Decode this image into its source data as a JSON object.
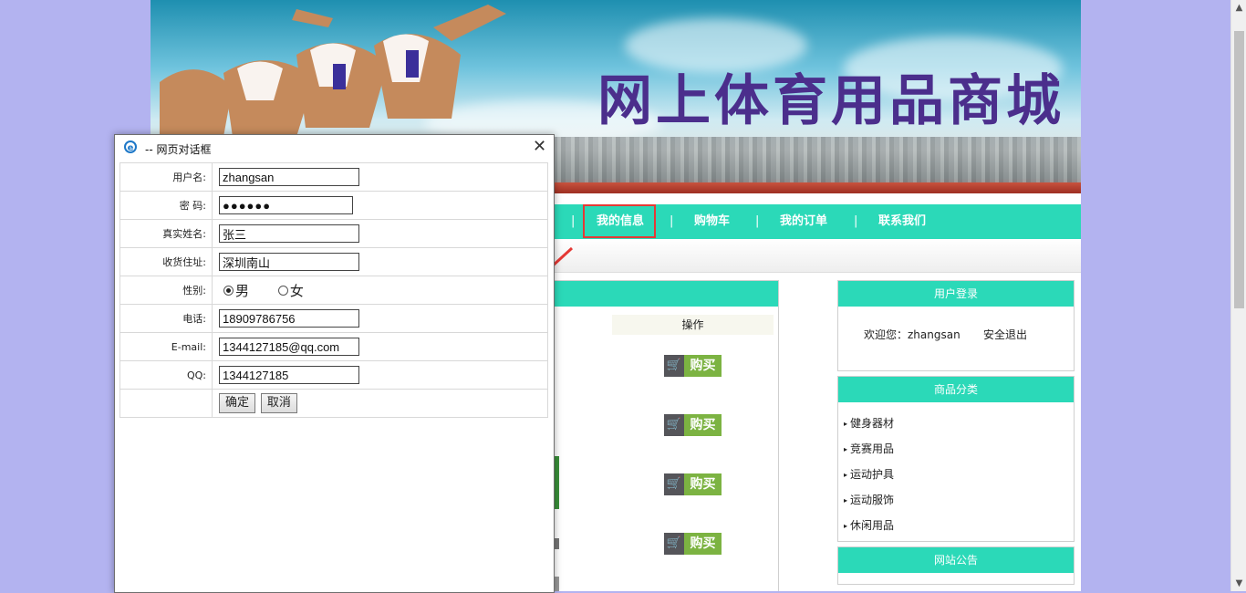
{
  "banner": {
    "title": "网上体育用品商城"
  },
  "nav": {
    "items": [
      "我的信息",
      "购物车",
      "我的订单",
      "联系我们"
    ],
    "separator": "|"
  },
  "products": {
    "column_header": "操作",
    "buy_label": "购买",
    "buy_count": 4
  },
  "login_box": {
    "title": "用户登录",
    "welcome": "欢迎您：zhangsan",
    "logout": "安全退出"
  },
  "category_box": {
    "title": "商品分类",
    "items": [
      "健身器材",
      "竞赛用品",
      "运动护具",
      "运动服饰",
      "休闲用品"
    ]
  },
  "notice_box": {
    "title": "网站公告"
  },
  "dialog": {
    "title": "-- 网页对话框",
    "fields": {
      "username": {
        "label": "用户名:",
        "value": "zhangsan"
      },
      "password": {
        "label": "密 码:",
        "value": "●●●●●●"
      },
      "realname": {
        "label": "真实姓名:",
        "value": "张三"
      },
      "address": {
        "label": "收货住址:",
        "value": "深圳南山"
      },
      "gender": {
        "label": "性别:",
        "options": [
          "男",
          "女"
        ],
        "selected": "男"
      },
      "phone": {
        "label": "电话:",
        "value": "18909786756"
      },
      "email": {
        "label": "E-mail:",
        "value": "1344127185@qq.com"
      },
      "qq": {
        "label": "QQ:",
        "value": "1344127185"
      }
    },
    "confirm": "确定",
    "cancel": "取消"
  },
  "colors": {
    "nav_bg": "#2bd9b8",
    "title_purple": "#4b2e8c",
    "buy_green": "#7cb342",
    "highlight_red": "#e53935",
    "outer_bg": "#b3b3f0"
  }
}
